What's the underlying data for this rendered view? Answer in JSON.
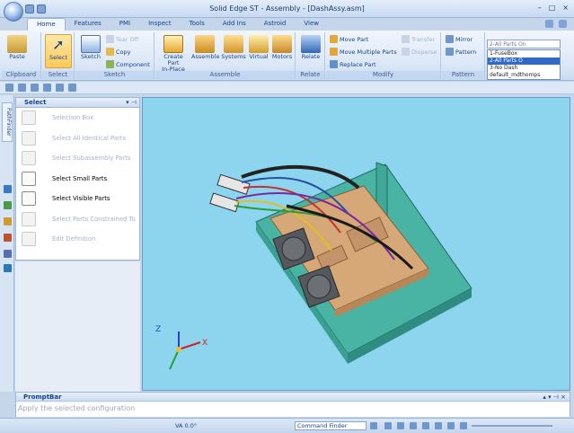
{
  "window": {
    "title": "Solid Edge ST - Assembly - [DashAssy.asm]",
    "controls": [
      "–",
      "□",
      "×"
    ]
  },
  "tabs": [
    "Home",
    "Features",
    "PMI",
    "Inspect",
    "Tools",
    "Add Ins",
    "Astroid",
    "View"
  ],
  "ribbon": {
    "clipboard": {
      "paste": "Paste",
      "group": "Clipboard"
    },
    "select": {
      "select": "Select",
      "group": "Select"
    },
    "sketch": {
      "sketch": "Sketch",
      "tear_off": "Tear Off",
      "copy": "Copy",
      "component": "Component",
      "group": "Sketch"
    },
    "assemble": {
      "create_part_line1": "Create Part",
      "create_part_line2": "In-Place",
      "assemble": "Assemble",
      "systems": "Systems",
      "virtual": "Virtual",
      "motors": "Motors",
      "group": "Assemble"
    },
    "relate": {
      "relate": "Relate",
      "group": "Relate"
    },
    "modify": {
      "move_part": "Move Part",
      "move_multiple": "Move Multiple Parts",
      "replace_part": "Replace Part",
      "transfer": "Transfer",
      "disperse": "Disperse",
      "group": "Modify"
    },
    "pattern": {
      "mirror": "Mirror",
      "pattern": "Pattern",
      "group": "Pattern"
    },
    "config": {
      "current": "2-All Parts On",
      "options": [
        "1-FuseBox",
        "2-All Parts O",
        "3-No Dash",
        "default_mdthomps"
      ],
      "selected_index": 1
    }
  },
  "left_strip": {
    "vertical_tab": "PathFinder"
  },
  "select_panel": {
    "title": "Select",
    "items": [
      {
        "label": "Selection Box",
        "enabled": false
      },
      {
        "label": "Select All Identical Parts",
        "enabled": false
      },
      {
        "label": "Select Subassembly Parts",
        "enabled": false
      },
      {
        "label": "Select Small Parts",
        "enabled": true
      },
      {
        "label": "Select Visible Parts",
        "enabled": true
      },
      {
        "label": "Select Parts Constrained To",
        "enabled": false
      },
      {
        "label": "Edit Definition",
        "enabled": false
      }
    ]
  },
  "viewport": {
    "triad": {
      "z": "Z",
      "x": "X"
    },
    "background": "#8dd5ef"
  },
  "prompt": {
    "title": "PromptBar",
    "text": "Apply the selected configuration"
  },
  "status": {
    "va": "VA 0.0°",
    "command_finder": "Command Finder"
  }
}
